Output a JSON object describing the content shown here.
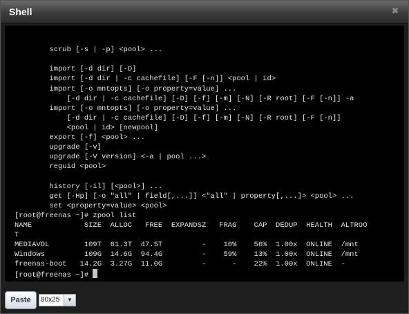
{
  "window": {
    "title": "Shell",
    "close_icon": "close-icon"
  },
  "terminal": {
    "lines": [
      "",
      "",
      "        scrub [-s | -p] <pool> ...",
      "",
      "        import [-d dir] [-D]",
      "        import [-d dir | -c cachefile] [-F [-n]] <pool | id>",
      "        import [-o mntopts] [-o property=value] ...",
      "            [-d dir | -c cachefile] [-D] [-f] [-m] [-N] [-R root] [-F [-n]] -a",
      "        import [-o mntopts] [-o property=value] ...",
      "            [-d dir | -c cachefile] [-D] [-f] [-m] [-N] [-R root] [-F [-n]]",
      "            <pool | id> [newpool]",
      "        export [-f] <pool> ...",
      "        upgrade [-v]",
      "        upgrade [-V version] <-a | pool ...>",
      "        reguid <pool>",
      "",
      "        history [-il] [<pool>] ...",
      "        get [-Hp] [-o \"all\" | field[,...]] <\"all\" | property[,...]> <pool> ...",
      "        set <property=value> <pool>",
      "[root@freenas ~]# zpool list",
      "NAME            SIZE  ALLOC   FREE  EXPANDSZ   FRAG    CAP  DEDUP  HEALTH  ALTROO",
      "T",
      "MEDIAVOL        109T  61.3T  47.5T         -    10%    56%  1.00x  ONLINE  /mnt",
      "Windows         109G  14.6G  94.4G         -    59%    13%  1.00x  ONLINE  /mnt",
      "freenas-boot   14.2G  3.27G  11.0G         -      -    22%  1.00x  ONLINE  -"
    ],
    "prompt": "[root@freenas ~]# "
  },
  "controls": {
    "paste_label": "Paste",
    "size_value": "80x25",
    "size_arrow_icon": "chevron-down-icon"
  }
}
